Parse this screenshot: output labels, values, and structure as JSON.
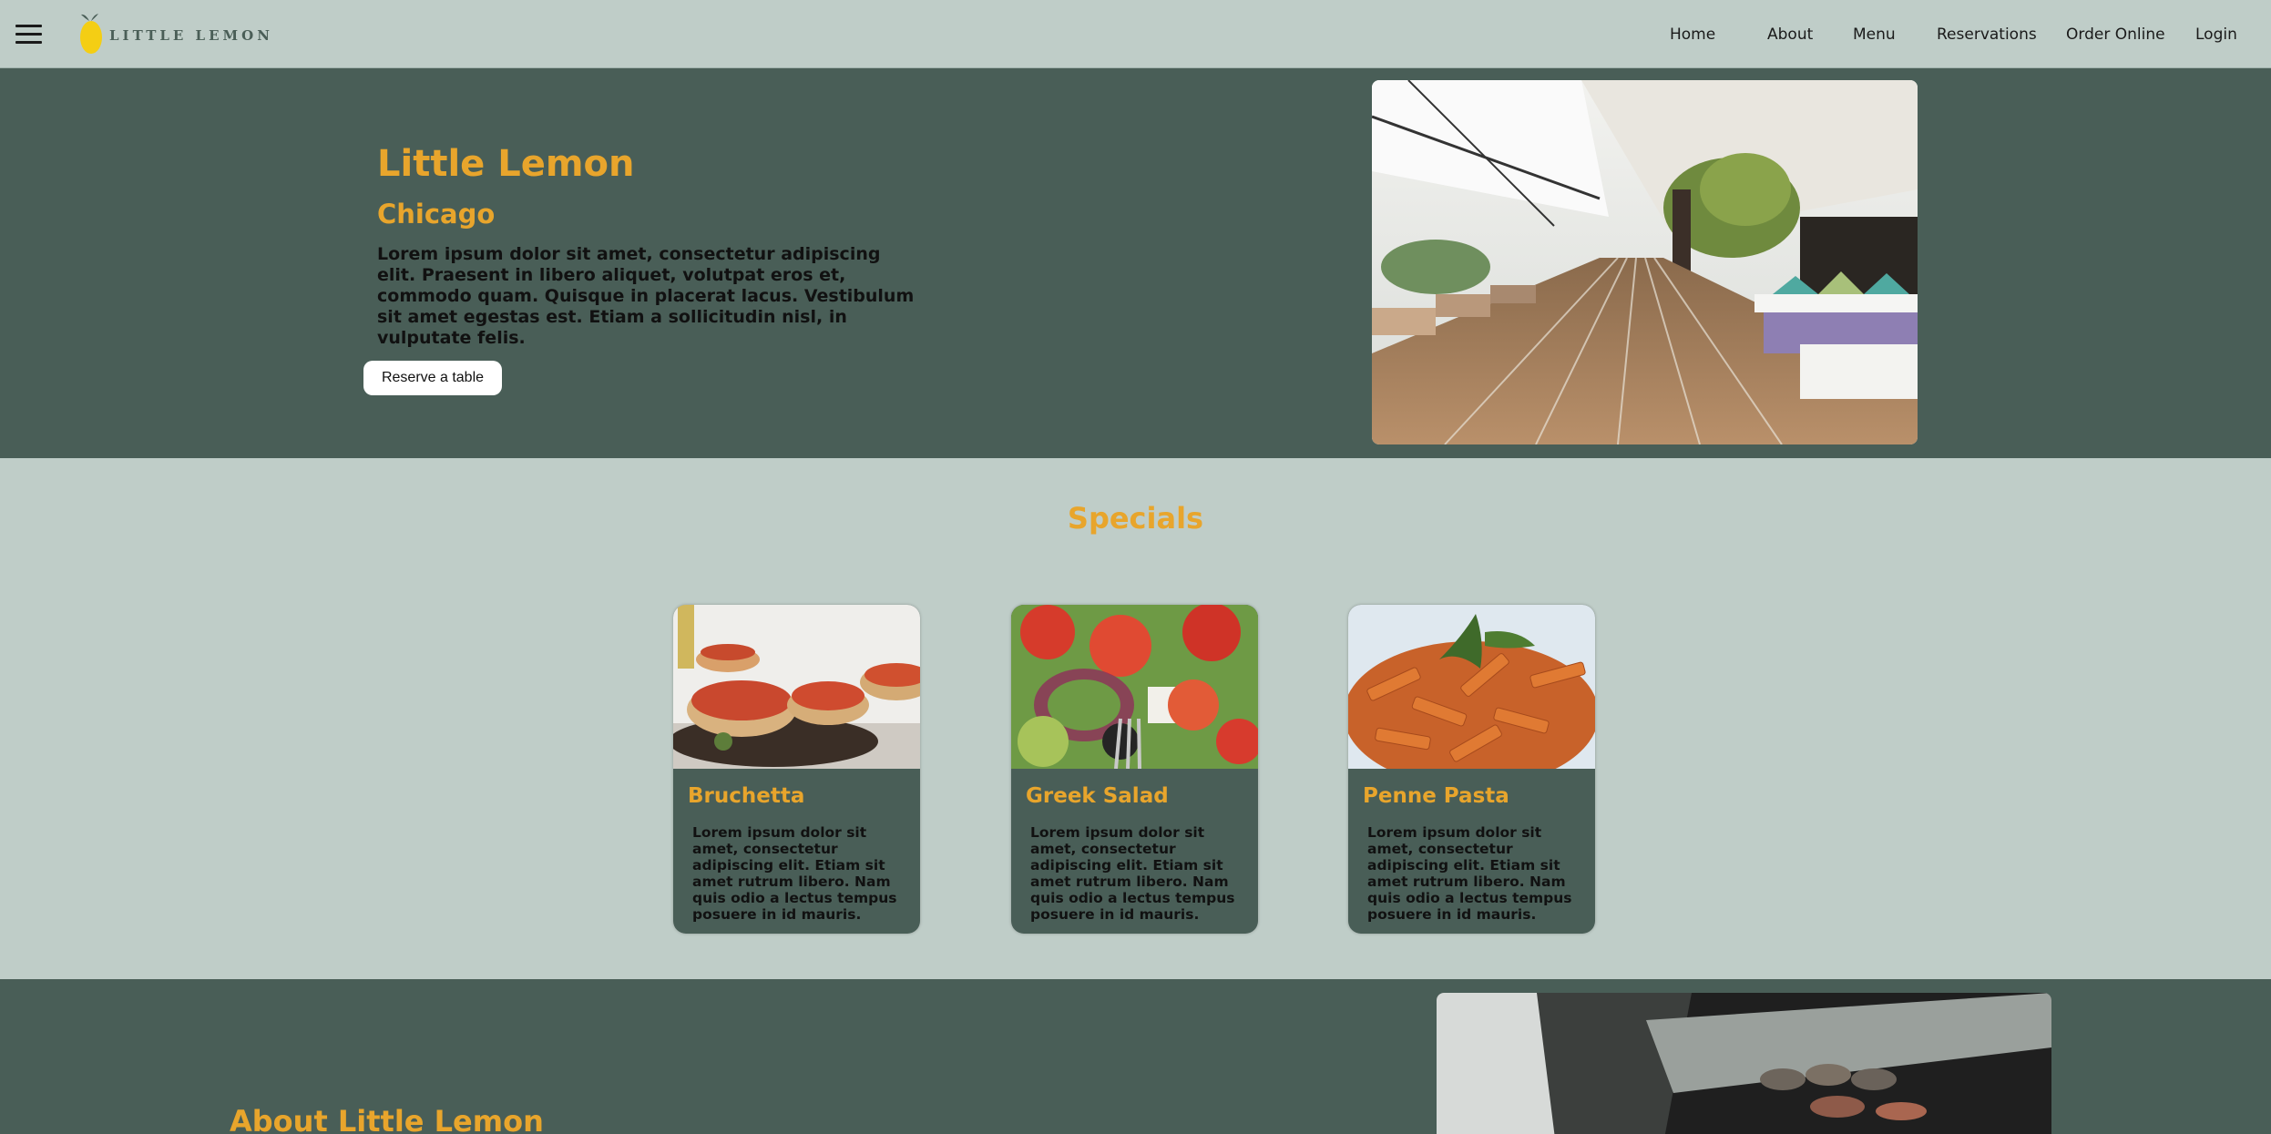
{
  "brand": {
    "logo_text": "LITTLE LEMON",
    "accent": "#e8a52c",
    "dark_green": "#495e57",
    "light_bg": "#bfcdc8"
  },
  "nav": {
    "menu_icon": "hamburger-icon",
    "links": [
      "Home",
      "About",
      "Menu",
      "Reservations",
      "Order Online",
      "Login"
    ]
  },
  "hero": {
    "title": "Little Lemon",
    "subtitle": "Chicago",
    "description": "Lorem ipsum dolor sit amet, consectetur adipiscing elit. Praesent in libero aliquet, volutpat eros et, commodo quam. Quisque in placerat lacus. Vestibulum sit amet egestas est. Etiam a sollicitudin nisl, in vulputate felis.",
    "button": "Reserve a table"
  },
  "specials": {
    "title": "Specials",
    "items": [
      {
        "name": "Bruchetta",
        "description": "Lorem ipsum dolor sit amet, consectetur adipiscing elit. Etiam sit amet rutrum libero. Nam quis odio a lectus tempus posuere in id mauris."
      },
      {
        "name": "Greek Salad",
        "description": "Lorem ipsum dolor sit amet, consectetur adipiscing elit. Etiam sit amet rutrum libero. Nam quis odio a lectus tempus posuere in id mauris."
      },
      {
        "name": "Penne Pasta",
        "description": "Lorem ipsum dolor sit amet, consectetur adipiscing elit. Etiam sit amet rutrum libero. Nam quis odio a lectus tempus posuere in id mauris."
      }
    ]
  },
  "about": {
    "title": "About Little Lemon"
  }
}
